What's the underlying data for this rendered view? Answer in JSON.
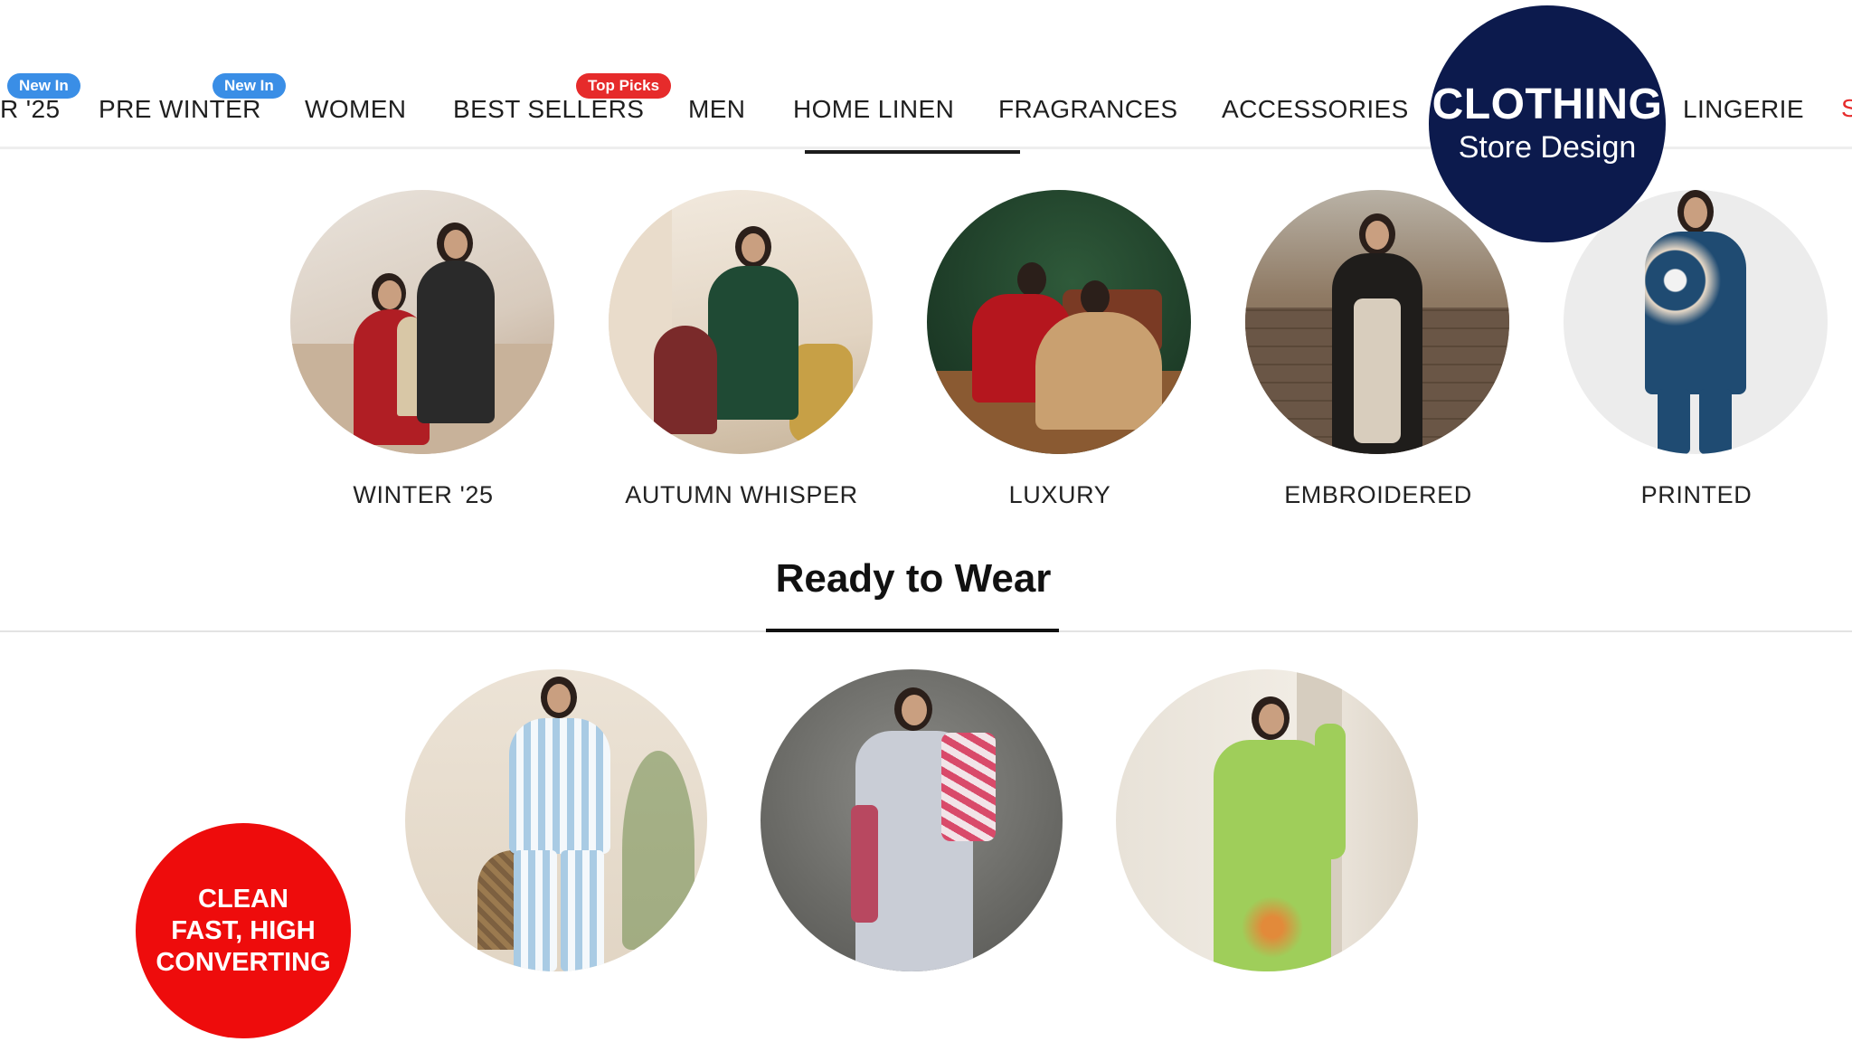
{
  "nav": {
    "items": [
      {
        "label": "R '25",
        "badge": "New In"
      },
      {
        "label": "PRE WINTER",
        "badge": "New In"
      },
      {
        "label": "WOMEN"
      },
      {
        "label": "BEST SELLERS",
        "badge": "Top Picks"
      },
      {
        "label": "MEN"
      },
      {
        "label": "HOME LINEN",
        "active": true
      },
      {
        "label": "FRAGRANCES"
      },
      {
        "label": "ACCESSORIES"
      },
      {
        "label": "LINGERIE"
      }
    ]
  },
  "promo": {
    "title": "CLOTHING",
    "subtitle": "Store Design",
    "tagline_lines": [
      "CLEAN",
      "FAST, HIGH",
      "CONVERTING"
    ]
  },
  "categories": [
    {
      "label": "WINTER '25"
    },
    {
      "label": "AUTUMN WHISPER"
    },
    {
      "label": "LUXURY"
    },
    {
      "label": "EMBROIDERED"
    },
    {
      "label": "PRINTED"
    }
  ],
  "ready_to_wear": {
    "title": "Ready to Wear"
  },
  "colors": {
    "badge_blue": "#3a8ee6",
    "badge_red": "#e62b2b",
    "promo_navy": "#0c1a4d",
    "promo_red": "#ee0c0c"
  }
}
